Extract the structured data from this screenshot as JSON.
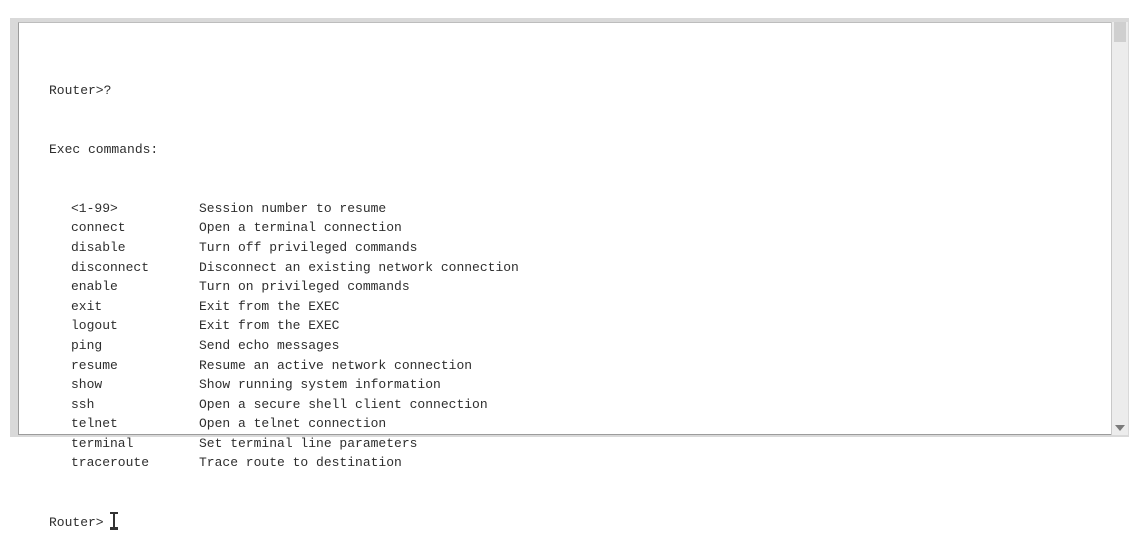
{
  "caption": "top-to-bottom overview with question mark, 'system' content",
  "terminal": {
    "prompt_line": "Router>?",
    "header": "Exec commands:",
    "commands": [
      {
        "cmd": "<1-99>",
        "desc": "Session number to resume"
      },
      {
        "cmd": "connect",
        "desc": "Open a terminal connection"
      },
      {
        "cmd": "disable",
        "desc": "Turn off privileged commands"
      },
      {
        "cmd": "disconnect",
        "desc": "Disconnect an existing network connection"
      },
      {
        "cmd": "enable",
        "desc": "Turn on privileged commands"
      },
      {
        "cmd": "exit",
        "desc": "Exit from the EXEC"
      },
      {
        "cmd": "logout",
        "desc": "Exit from the EXEC"
      },
      {
        "cmd": "ping",
        "desc": "Send echo messages"
      },
      {
        "cmd": "resume",
        "desc": "Resume an active network connection"
      },
      {
        "cmd": "show",
        "desc": "Show running system information"
      },
      {
        "cmd": "ssh",
        "desc": "Open a secure shell client connection"
      },
      {
        "cmd": "telnet",
        "desc": "Open a telnet connection"
      },
      {
        "cmd": "terminal",
        "desc": "Set terminal line parameters"
      },
      {
        "cmd": "traceroute",
        "desc": "Trace route to destination"
      }
    ],
    "final_prompt": "Router>"
  },
  "icons": {
    "text_cursor": "text-cursor-icon",
    "scroll_down": "scroll-down-arrow-icon"
  }
}
